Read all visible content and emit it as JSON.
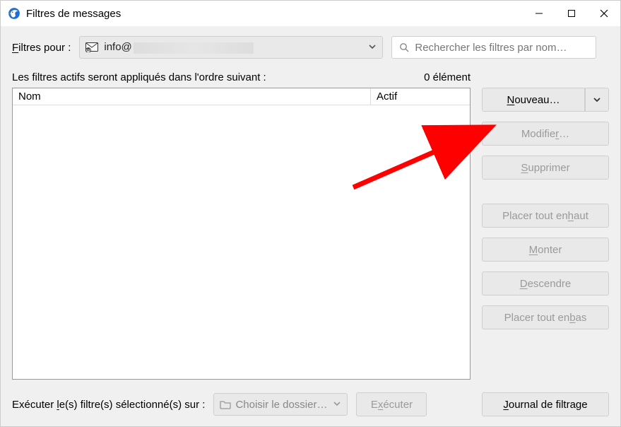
{
  "window": {
    "title": "Filtres de messages"
  },
  "top": {
    "label_pre": "F",
    "label_post": "iltres pour :",
    "account_visible": "info@",
    "search_placeholder": "Rechercher les filtres par nom…"
  },
  "mid": {
    "caption": "Les filtres actifs seront appliqués dans l'ordre suivant :",
    "count": "0 élément",
    "col_nom": "Nom",
    "col_actif": "Actif"
  },
  "buttons": {
    "nouveau_pre": "N",
    "nouveau_post": "ouveau…",
    "modifier_pre": "Modifie",
    "modifier_u": "r",
    "modifier_post": "…",
    "supprimer_pre": "S",
    "supprimer_post": "upprimer",
    "haut_pre": "Placer tout en ",
    "haut_u": "h",
    "haut_post": "aut",
    "monter_pre": "M",
    "monter_post": "onter",
    "descendre_pre": "D",
    "descendre_post": "escendre",
    "bas_pre": "Placer tout en ",
    "bas_u": "b",
    "bas_post": "as"
  },
  "bottom": {
    "label_pre": "Exécuter ",
    "label_u": "l",
    "label_post": "e(s) filtre(s) sélectionné(s) sur :",
    "folder_placeholder": "Choisir le dossier…",
    "executer_pre": "E",
    "executer_u": "x",
    "executer_post": "écuter",
    "journal_pre": "J",
    "journal_post": "ournal de filtrage"
  }
}
